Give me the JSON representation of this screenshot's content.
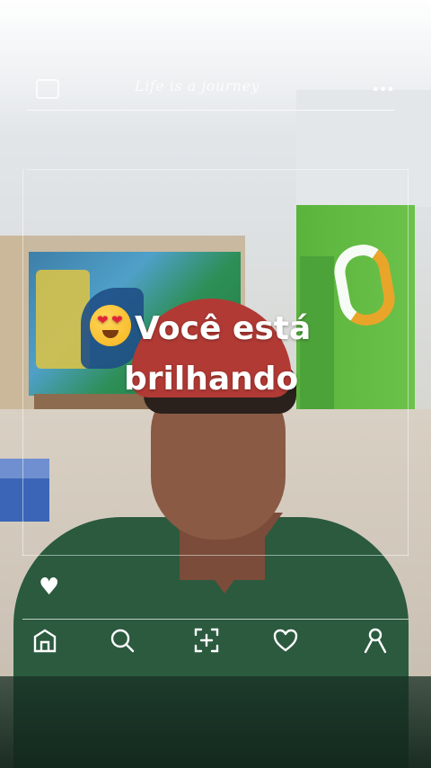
{
  "header": {
    "script_text": "Life is a journey",
    "menu_icon": "more-dots-icon"
  },
  "caption": {
    "emoji": "heart-eyes-emoji",
    "line1": "Você está",
    "line2": "brilhando"
  },
  "like_icon": "heart-icon",
  "nav": {
    "items": [
      {
        "icon": "home-icon"
      },
      {
        "icon": "search-icon"
      },
      {
        "icon": "add-icon"
      },
      {
        "icon": "heart-outline-icon"
      },
      {
        "icon": "profile-icon"
      }
    ]
  },
  "colors": {
    "overlay_text": "#ffffff",
    "frame": "#ffffff"
  }
}
